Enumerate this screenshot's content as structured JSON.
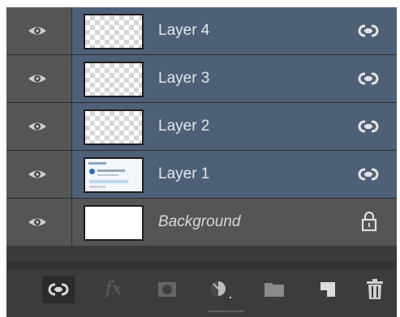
{
  "layers_panel": {
    "layers": [
      {
        "name": "Layer 4",
        "thumb": "transparent",
        "link_icon": "link-icon",
        "visible": true
      },
      {
        "name": "Layer 3",
        "thumb": "transparent",
        "link_icon": "link-icon",
        "visible": true
      },
      {
        "name": "Layer 2",
        "thumb": "transparent",
        "link_icon": "link-icon",
        "visible": true
      },
      {
        "name": "Layer 1",
        "thumb": "screenshot",
        "link_icon": "link-icon",
        "visible": true
      },
      {
        "name": "Background",
        "thumb": "white",
        "lock_icon": "lock-icon",
        "visible": true
      }
    ],
    "footer_buttons": [
      {
        "icon": "link-layers-icon"
      },
      {
        "icon": "fx-icon",
        "label": "fx"
      },
      {
        "icon": "add-mask-icon"
      },
      {
        "icon": "adjustment-layer-icon"
      },
      {
        "icon": "new-group-folder-icon"
      },
      {
        "icon": "new-layer-icon"
      },
      {
        "icon": "trash-icon"
      }
    ],
    "colors": {
      "selected_row": "#4e6077",
      "panel_bg": "#3b3b3b",
      "row_bg": "#555555"
    }
  }
}
